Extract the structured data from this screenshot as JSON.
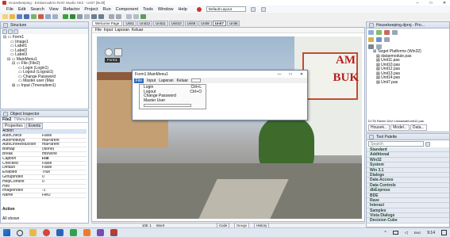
{
  "titlebar": {
    "title": "Housekeeping - Embarcadero RAD Studio XE2 - Unit7 [Built]"
  },
  "menu": [
    "File",
    "Edit",
    "Search",
    "View",
    "Refactor",
    "Project",
    "Run",
    "Component",
    "Tools",
    "Window",
    "Help"
  ],
  "layout_combo": "Default Layout",
  "tabs": [
    "Welcome Page",
    "Unit1",
    "Unit12",
    "Unit11",
    "Unit10",
    "Unit9",
    "Unit8",
    "Unit7",
    "Unit6"
  ],
  "structure": {
    "title": "Structure",
    "items": [
      "Form1",
      "Image1",
      "Label1",
      "Label2",
      "Label3",
      "MainMenu1",
      "File (File2)",
      "Login (Login1)",
      "Logout (Logout1)",
      "Change Password",
      "Master user (Mas",
      "Input (Tmenuitem1)"
    ]
  },
  "inspector": {
    "title": "Object Inspector",
    "object": "File2",
    "object_type": "TMenuItem",
    "tabs": [
      "Properties",
      "Events"
    ],
    "rows": [
      [
        "Action",
        ""
      ],
      [
        "AutoCheck",
        "False"
      ],
      [
        "AutoHotkeys",
        "maParent"
      ],
      [
        "AutoLineReduction",
        "maParent"
      ],
      [
        "Bitmap",
        "(None)"
      ],
      [
        "Break",
        "mbNone"
      ],
      [
        "Caption",
        "File"
      ],
      [
        "Checked",
        "False"
      ],
      [
        "Default",
        "False"
      ],
      [
        "Enabled",
        "True"
      ],
      [
        "GroupIndex",
        "0"
      ],
      [
        "HelpContext",
        "0"
      ],
      [
        "Hint",
        ""
      ],
      [
        "ImageIndex",
        "-1"
      ],
      [
        "Name",
        "File2"
      ]
    ],
    "footer": "Action",
    "status": "All shown"
  },
  "designer": {
    "menubar": "File  Input  Laporan  Keluar",
    "image_text_1": "AM",
    "image_text_2": "BUK",
    "form_label": "Form1"
  },
  "popup": {
    "title": "Form1.MainMenu1",
    "menu": [
      "File",
      "Input",
      "Laporan",
      "Keluar"
    ],
    "items": [
      {
        "label": "Login",
        "shortcut": "Ctrl+L"
      },
      {
        "label": "Logout",
        "shortcut": "Ctrl+O"
      },
      {
        "label": "Change Password",
        "shortcut": ""
      },
      {
        "label": "Master User",
        "shortcut": ""
      }
    ]
  },
  "statusbar": {
    "pos": "105: 1",
    "mode": "Insert",
    "tabs": [
      "Code",
      "Design",
      "History"
    ]
  },
  "project_manager": {
    "title": "Housekeeping.dproj - Pro...",
    "items": [
      "Target Platforms (Win32)",
      "dataemodule.pas",
      "Unit11.pas",
      "Unit10.pas",
      "Unit12.pas",
      "Unit13.pas",
      "Unit14.pas",
      "Unit7.pas"
    ],
    "path": "D:\\TA Raven Devi Lismawati\\unit12.pas",
    "tabs": [
      "Housek...",
      "Model...",
      "Data..."
    ]
  },
  "palette": {
    "title": "Tool Palette",
    "search": "Search",
    "categories": [
      "Standard",
      "Additional",
      "Win32",
      "System",
      "Win 3.1",
      "Dialogs",
      "Data Access",
      "Data Controls",
      "dbExpress",
      "BDE",
      "Rave",
      "Interact",
      "Samples",
      "Vista Dialogs",
      "Decision Cube"
    ]
  },
  "taskbar": {
    "time": "9:14",
    "locale": "ENG"
  },
  "colors": {
    "accent": "#3a6ea5",
    "taskbar": "#dfe7f1"
  }
}
